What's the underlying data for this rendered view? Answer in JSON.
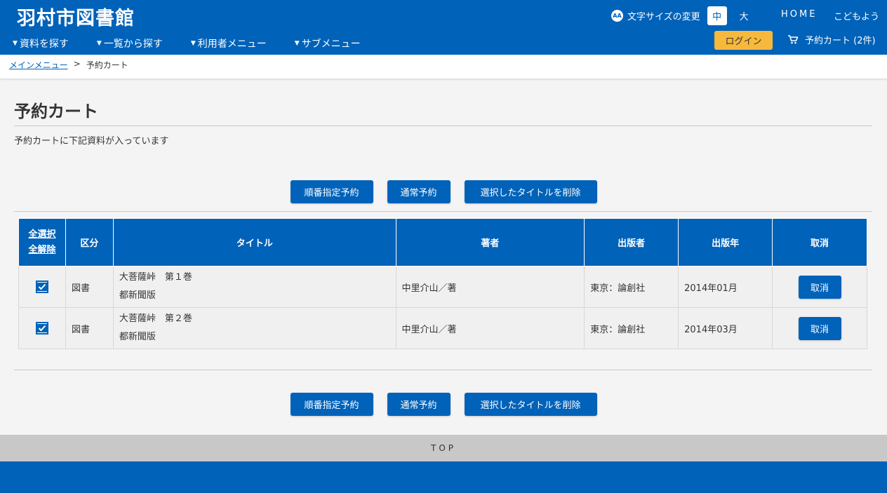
{
  "header": {
    "site_title": "羽村市図書館",
    "nav": [
      "資料を探す",
      "一覧から探す",
      "利用者メニュー",
      "サブメニュー"
    ],
    "font_size_label": "文字サイズの変更",
    "font_size_icon_text": "AA",
    "size_mid": "中",
    "size_large": "大",
    "home": "HOME",
    "kids": "こどもよう",
    "login": "ログイン",
    "cart": "予約カート (2件)"
  },
  "breadcrumb": {
    "main_menu": "メインメニュー",
    "separator": ">",
    "current": "予約カート"
  },
  "page": {
    "title": "予約カート",
    "intro": "予約カートに下記資料が入っています"
  },
  "actions": {
    "ordered_reserve": "順番指定予約",
    "normal_reserve": "通常予約",
    "delete_selected": "選択したタイトルを削除"
  },
  "table": {
    "select_all": "全選択",
    "deselect_all": "全解除",
    "headers": [
      "区分",
      "タイトル",
      "著者",
      "出版者",
      "出版年",
      "取消"
    ],
    "rows": [
      {
        "checked": true,
        "category": "図書",
        "title_line1": "大菩薩峠　第１巻",
        "title_line2": "都新聞版",
        "author": "中里介山／著",
        "publisher": "東京：論創社",
        "year": "2014年01月",
        "cancel": "取消"
      },
      {
        "checked": true,
        "category": "図書",
        "title_line1": "大菩薩峠　第２巻",
        "title_line2": "都新聞版",
        "author": "中里介山／著",
        "publisher": "東京：論創社",
        "year": "2014年03月",
        "cancel": "取消"
      }
    ]
  },
  "footer": {
    "top": "TOP"
  },
  "colors": {
    "brand": "#0062b9",
    "login": "#f6b93b"
  }
}
